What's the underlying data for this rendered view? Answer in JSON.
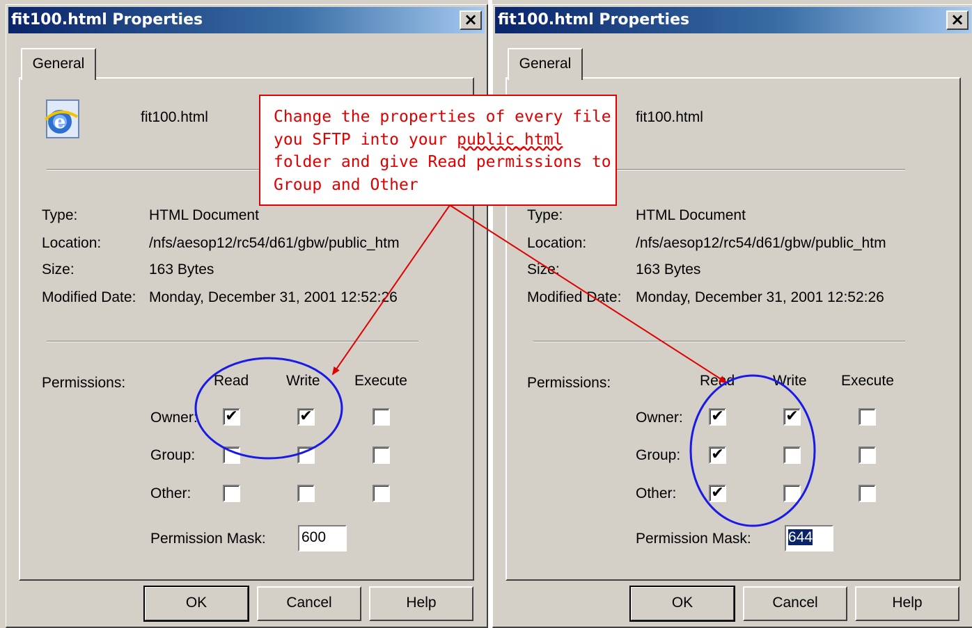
{
  "dialogs": [
    {
      "title": "fit100.html Properties",
      "close": "×",
      "tab": "General",
      "filename": "fit100.html",
      "props": {
        "type_label": "Type:",
        "type_value": "HTML Document",
        "location_label": "Location:",
        "location_value": "/nfs/aesop12/rc54/d61/gbw/public_htm",
        "size_label": "Size:",
        "size_value": "163 Bytes",
        "modified_label": "Modified Date:",
        "modified_value": "Monday, December 31, 2001 12:52:26"
      },
      "permissions": {
        "label": "Permissions:",
        "columns": [
          "Read",
          "Write",
          "Execute"
        ],
        "rows": [
          {
            "label": "Owner:",
            "checks": [
              true,
              true,
              false
            ]
          },
          {
            "label": "Group:",
            "checks": [
              false,
              false,
              false
            ]
          },
          {
            "label": "Other:",
            "checks": [
              false,
              false,
              false
            ]
          }
        ],
        "mask_label": "Permission Mask:",
        "mask_value": "600"
      },
      "buttons": {
        "ok": "OK",
        "cancel": "Cancel",
        "help": "Help"
      }
    },
    {
      "title": "fit100.html Properties",
      "close": "×",
      "tab": "General",
      "filename": "fit100.html",
      "props": {
        "type_label": "Type:",
        "type_value": "HTML Document",
        "location_label": "Location:",
        "location_value": "/nfs/aesop12/rc54/d61/gbw/public_htm",
        "size_label": "Size:",
        "size_value": "163 Bytes",
        "modified_label": "Modified Date:",
        "modified_value": "Monday, December 31, 2001 12:52:26"
      },
      "permissions": {
        "label": "Permissions:",
        "columns": [
          "Read",
          "Write",
          "Execute"
        ],
        "rows": [
          {
            "label": "Owner:",
            "checks": [
              true,
              true,
              false
            ]
          },
          {
            "label": "Group:",
            "checks": [
              true,
              false,
              false
            ]
          },
          {
            "label": "Other:",
            "checks": [
              true,
              false,
              false
            ]
          }
        ],
        "mask_label": "Permission Mask:",
        "mask_value": "644"
      },
      "buttons": {
        "ok": "OK",
        "cancel": "Cancel",
        "help": "Help"
      }
    }
  ],
  "callout": {
    "line1": "Change the properties of every file",
    "line2_pre": "you SFTP into your ",
    "line2_word": "public_html",
    "line3": "folder and give Read permissions to",
    "line4": "Group and Other"
  },
  "colors": {
    "title_gradient_start": "#0a246a",
    "title_gradient_end": "#a6caf0",
    "dialog_face": "#d4d0c8",
    "annotation_red": "#e00000",
    "annotation_blue": "#1a1ae6",
    "selection_highlight": "#0a246a"
  },
  "icons": {
    "file": "internet-explorer-html-icon",
    "checkmark": "✔"
  }
}
